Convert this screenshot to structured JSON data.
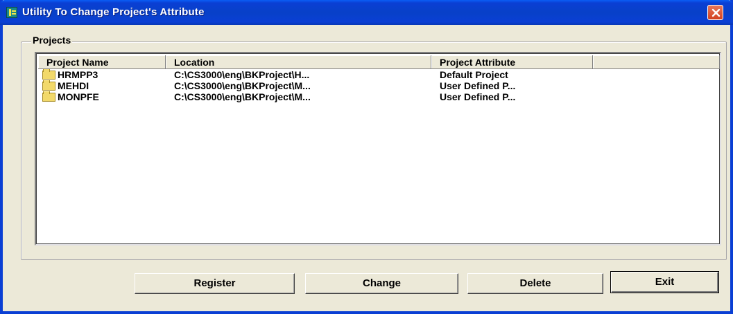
{
  "window": {
    "title": "Utility To Change Project's Attribute",
    "icon": "app-icon",
    "close_icon": "close-icon"
  },
  "projects_group": {
    "label": "Projects",
    "columns": [
      "Project Name",
      "Location",
      "Project Attribute",
      ""
    ],
    "rows": [
      {
        "name": "HRMPP3",
        "location": "C:\\CS3000\\eng\\BKProject\\H...",
        "attribute": "Default Project",
        "icon": "folder-icon"
      },
      {
        "name": "MEHDI",
        "location": "C:\\CS3000\\eng\\BKProject\\M...",
        "attribute": "User Defined P...",
        "icon": "folder-icon"
      },
      {
        "name": "MONPFE",
        "location": "C:\\CS3000\\eng\\BKProject\\M...",
        "attribute": "User Defined P...",
        "icon": "folder-icon"
      }
    ]
  },
  "buttons": {
    "register": "Register",
    "change": "Change",
    "delete": "Delete",
    "exit": "Exit"
  },
  "colors": {
    "titlebar": "#0a3fd4",
    "dialog_bg": "#ece9d8",
    "close_button": "#d2411f"
  }
}
